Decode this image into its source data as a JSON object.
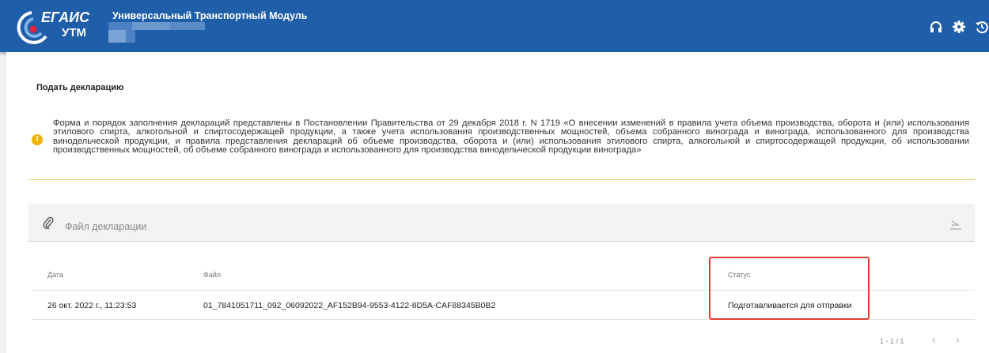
{
  "header": {
    "logo_top": "ЕГАИС",
    "logo_bottom": "УТМ",
    "app_title": "Универсальный Транспортный Модуль",
    "icons": [
      "headset-icon",
      "gear-icon",
      "history-icon"
    ]
  },
  "page": {
    "title": "Подать декларацию",
    "notice": "Форма и порядок заполнения деклараций представлены в Постановлении Правительства от 29 декабря 2018 г. N 1719 «О внесении изменений в правила учета объема производства, оборота и (или) использования этилового спирта, алкогольной и спиртосодержащей продукции, а также учета использования производственных мощностей, объема собранного винограда и винограда, использованного для производства винодельческой продукции, и правила представления деклараций об объеме производства, оборота и (или) использования этилового спирта, алкогольной и спиртосодержащей продукции, об использовании производственных мощностей, об объеме собранного винограда и использованного для производства винодельческой продукции винограда»"
  },
  "upload": {
    "placeholder": "Файл декларации"
  },
  "table": {
    "columns": [
      "Дата",
      "Файл",
      "Статус"
    ],
    "rows": [
      {
        "date": "26 окт. 2022 г., 11:23:53",
        "file": "01_7841051711_092_06092022_AF152B94-9553-4122-8D5A-CAF88345B0B2",
        "status": "Подготавливается для отправки"
      }
    ]
  },
  "pagination": {
    "range": "1 - 1 / 1",
    "prev": "‹",
    "next": "›"
  },
  "colors": {
    "header": "#1f5ea8",
    "warning": "#f0b400",
    "highlight": "#e33b33"
  }
}
